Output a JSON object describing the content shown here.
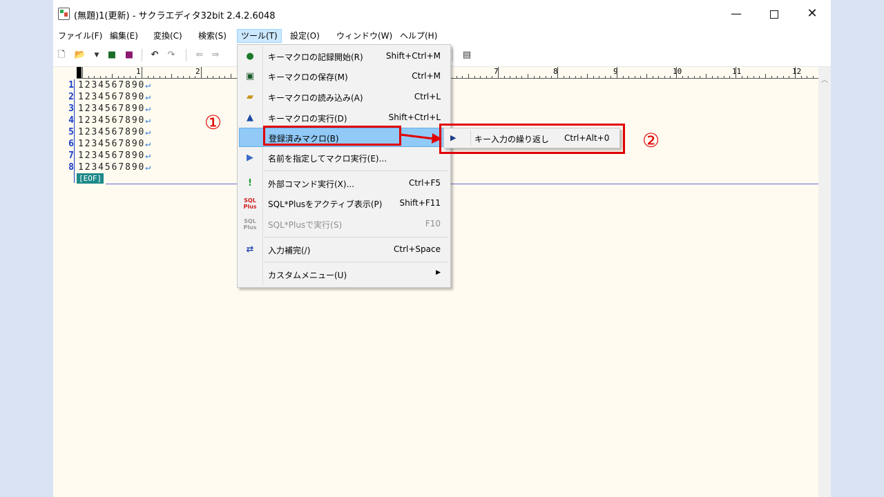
{
  "window": {
    "title": "(無題)1(更新) - サクラエディタ32bit 2.4.2.6048",
    "min_glyph": "—",
    "close_glyph": "✕"
  },
  "menubar": {
    "items": [
      {
        "label": "ファイル(F)"
      },
      {
        "label": "編集(E)"
      },
      {
        "label": "変換(C)"
      },
      {
        "label": "検索(S)"
      },
      {
        "label": "ツール(T)",
        "active": true
      },
      {
        "label": "設定(O)"
      },
      {
        "label": "ウィンドウ(W)"
      },
      {
        "label": "ヘルプ(H)"
      }
    ]
  },
  "toolbar": {
    "icons": [
      "new-file-icon",
      "open-folder-icon",
      "dropdown-arrow-icon",
      "save-icon",
      "save-all-icon",
      "undo-icon",
      "redo-icon",
      "jump-back-icon",
      "jump-forward-icon",
      "window-list-icon"
    ]
  },
  "editor": {
    "ruler_numbers": [
      "1",
      "2",
      "7",
      "8",
      "9",
      "10",
      "11",
      "12"
    ],
    "line_numbers": [
      "1",
      "2",
      "3",
      "4",
      "5",
      "6",
      "7",
      "8"
    ],
    "line_text": "1234567890",
    "return_glyph": "↵",
    "eof_label": "[EOF]",
    "colors": {
      "background": "#fffbf0",
      "line_number": "#1a3cc8",
      "eof_bg": "#1e8a8a"
    }
  },
  "tools_menu": {
    "items": [
      {
        "label": "キーマクロの記録開始(R)",
        "shortcut": "Shift+Ctrl+M",
        "icon": "record-macro-icon"
      },
      {
        "label": "キーマクロの保存(M)",
        "shortcut": "Ctrl+M",
        "icon": "save-macro-icon"
      },
      {
        "label": "キーマクロの読み込み(A)",
        "shortcut": "Ctrl+L",
        "icon": "load-macro-icon"
      },
      {
        "label": "キーマクロの実行(D)",
        "shortcut": "Shift+Ctrl+L",
        "icon": "run-macro-icon"
      },
      {
        "label": "登録済みマクロ(B)",
        "shortcut": "",
        "icon": "",
        "highlight": true
      },
      {
        "label": "名前を指定してマクロ実行(E)...",
        "shortcut": "",
        "icon": "named-macro-icon"
      },
      {
        "label": "外部コマンド実行(X)...",
        "shortcut": "Ctrl+F5",
        "icon": "external-command-icon"
      },
      {
        "label": "SQL*Plusをアクティブ表示(P)",
        "shortcut": "Shift+F11",
        "icon": "sqlplus-active-icon"
      },
      {
        "label": "SQL*Plusで実行(S)",
        "shortcut": "F10",
        "icon": "sqlplus-run-icon",
        "disabled": true
      },
      {
        "label": "入力補完(/)",
        "shortcut": "Ctrl+Space",
        "icon": "completion-icon"
      },
      {
        "label": "カスタムメニュー(U)",
        "shortcut": "",
        "icon": "",
        "submenu": true
      }
    ],
    "submenu_arrow": "▶"
  },
  "submenu": {
    "label": "キー入力の繰り返し",
    "shortcut": "Ctrl+Alt+0",
    "icon": "macro-play-icon"
  },
  "annotations": {
    "num1": "①",
    "num2": "②",
    "color": "#e00000"
  }
}
